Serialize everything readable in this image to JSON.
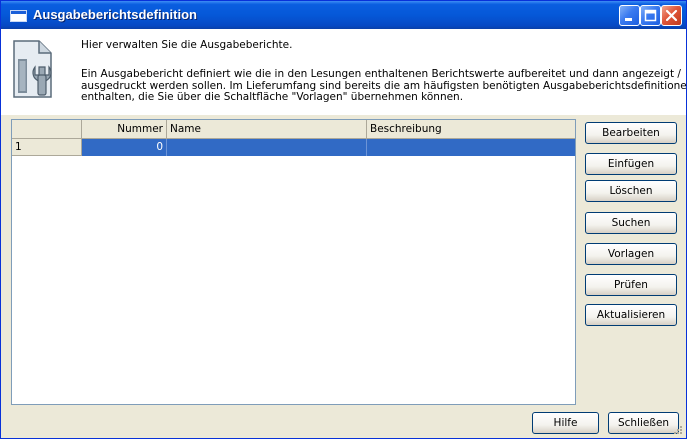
{
  "window": {
    "title": "Ausgabeberichtsdefinition"
  },
  "header": {
    "intro": "Hier verwalten Sie die Ausgabeberichte.",
    "description_lines": [
      "Ein Ausgabebericht definiert wie die in den Lesungen enthaltenen Berichtswerte aufbereitet und dann angezeigt /",
      "ausgedruckt werden sollen. Im Lieferumfang sind bereits die am häufigsten benötigten Ausgabeberichtsdefinitionen",
      "enthalten, die Sie über die Schaltfläche \"Vorlagen\" übernehmen können."
    ],
    "icon": "document-wrench-icon"
  },
  "table": {
    "columns": [
      "",
      "Nummer",
      "Name",
      "Beschreibung"
    ],
    "rows": [
      {
        "index": "1",
        "nummer": "0",
        "name": "",
        "beschreibung": ""
      }
    ]
  },
  "side_buttons": [
    "Bearbeiten",
    "Einfügen",
    "Löschen",
    "Suchen",
    "Vorlagen",
    "Prüfen",
    "Aktualisieren"
  ],
  "footer_buttons": {
    "help": "Hilfe",
    "close": "Schließen"
  },
  "colors": {
    "titlebar": "#0558d8",
    "selection": "#316ac5",
    "dialog_bg": "#ece9d8"
  }
}
